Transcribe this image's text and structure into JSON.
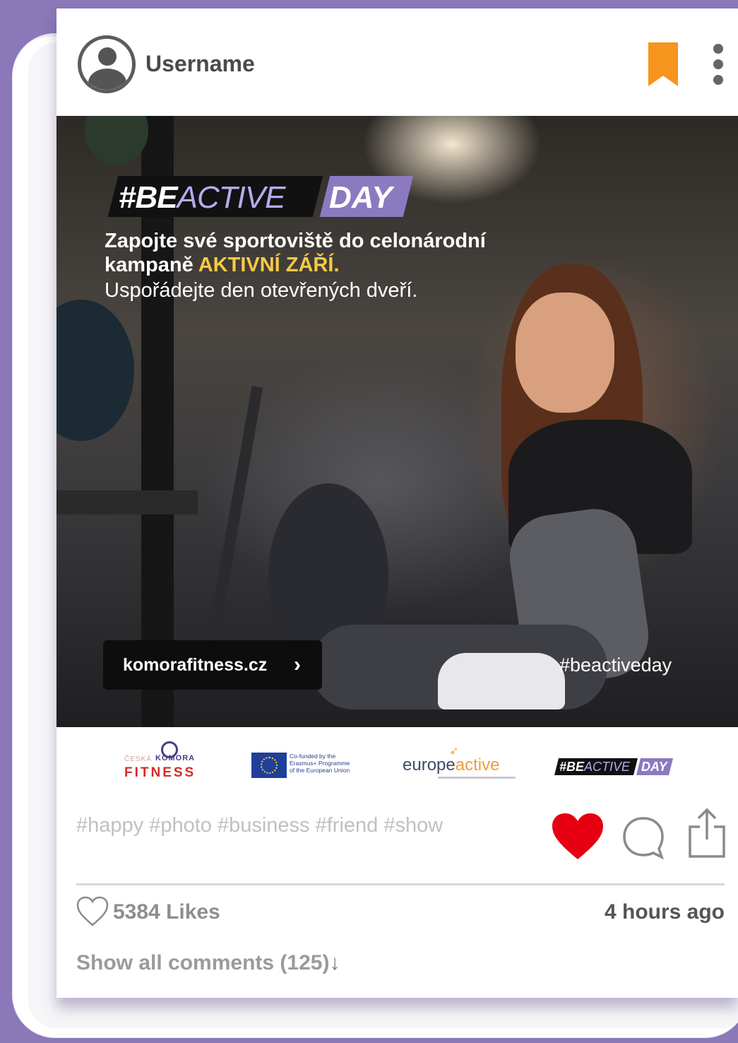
{
  "header": {
    "username": "Username",
    "bookmark_icon": "bookmark-icon",
    "more_icon": "more-vertical-icon",
    "bookmark_color": "#f7941d"
  },
  "post_image": {
    "tag_black": "#BE",
    "tag_black_light": "ACTIVE",
    "tag_purple": "DAY",
    "headline_line1": "Zapojte své sportoviště do celonárodní",
    "headline_line2_prefix": "kampaně ",
    "headline_highlight": "AKTIVNÍ ZÁŘÍ",
    "headline_suffix": ".",
    "subline": "Uspořádejte den otevřených dveří.",
    "cta_label": "komorafitness.cz",
    "cta_chevron": "›",
    "hashtag": "#beactiveday",
    "accent_purple": "#8b7ac0",
    "accent_yellow": "#f6c945"
  },
  "logos": {
    "komora_small": "ČESKÁ",
    "komora_name": "KOMORA",
    "komora_fitness": "FITNESS",
    "eu_text_1": "Co-funded by the",
    "eu_text_2": "Erasmus+ Programme",
    "eu_text_3": "of the European Union",
    "europeactive_1": "europe",
    "europeactive_2": "active",
    "beactive_black": "#BE",
    "beactive_light": "ACTIVE",
    "beactive_day": "DAY"
  },
  "caption": {
    "tags": "#happy #photo #business #friend #show"
  },
  "actions": {
    "like_icon": "heart-filled-icon",
    "comment_icon": "comment-bubble-icon",
    "share_icon": "share-icon",
    "like_color": "#e60012"
  },
  "footer": {
    "likes": "5384 Likes",
    "time": "4 hours ago",
    "show_comments": "Show all comments (125)",
    "show_comments_arrow": "↓"
  }
}
